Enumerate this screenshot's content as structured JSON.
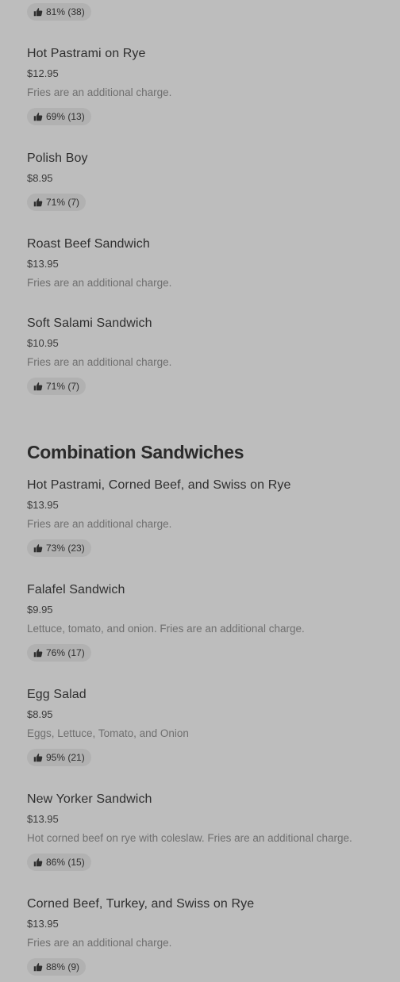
{
  "top_rating": {
    "text": "81% (38)"
  },
  "items_a": [
    {
      "name": "Hot Pastrami on Rye",
      "price": "$12.95",
      "desc": "Fries are an additional charge.",
      "rating": "69% (13)"
    },
    {
      "name": "Polish Boy",
      "price": "$8.95",
      "rating": "71% (7)"
    },
    {
      "name": "Roast Beef Sandwich",
      "price": "$13.95",
      "desc": "Fries are an additional charge."
    },
    {
      "name": "Soft Salami Sandwich",
      "price": "$10.95",
      "desc": "Fries are an additional charge.",
      "rating": "71% (7)"
    }
  ],
  "section": {
    "title": "Combination Sandwiches"
  },
  "items_b": [
    {
      "name": "Hot Pastrami, Corned Beef, and Swiss on Rye",
      "price": "$13.95",
      "desc": "Fries are an additional charge.",
      "rating": "73% (23)"
    },
    {
      "name": "Falafel Sandwich",
      "price": "$9.95",
      "desc": "Lettuce, tomato, and onion. Fries are an additional charge.",
      "rating": "76% (17)"
    },
    {
      "name": "Egg Salad",
      "price": "$8.95",
      "desc": "Eggs, Lettuce, Tomato, and Onion",
      "rating": "95% (21)"
    },
    {
      "name": "New Yorker Sandwich",
      "price": "$13.95",
      "desc": "Hot corned beef on rye with coleslaw. Fries are an additional charge.",
      "rating": "86% (15)"
    },
    {
      "name": "Corned Beef, Turkey, and Swiss on Rye",
      "price": "$13.95",
      "desc": "Fries are an additional charge.",
      "rating": "88% (9)"
    }
  ],
  "icons": {
    "rating": "thumbs-up-icon"
  }
}
